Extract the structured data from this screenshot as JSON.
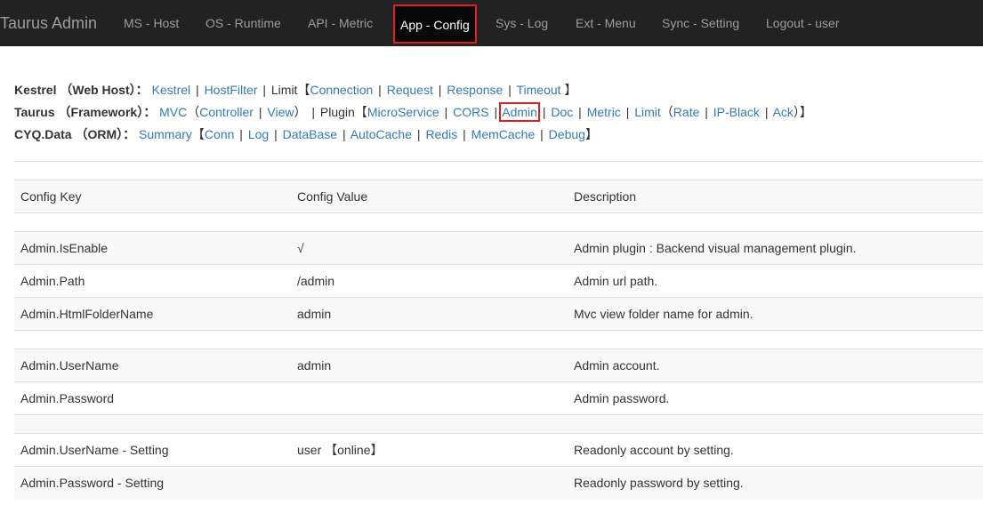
{
  "navbar": {
    "brand": "Taurus Admin",
    "items": [
      {
        "label": "MS - Host"
      },
      {
        "label": "OS - Runtime"
      },
      {
        "label": "API - Metric"
      },
      {
        "label": "App - Config",
        "active": true
      },
      {
        "label": "Sys - Log"
      },
      {
        "label": "Ext - Menu"
      },
      {
        "label": "Sync - Setting"
      },
      {
        "label": "Logout - user"
      }
    ]
  },
  "config_nav": {
    "kestrel": {
      "title": "Kestrel （Web Host）：",
      "kestrel": "Kestrel",
      "hostfilter": "HostFilter",
      "limit": "Limit",
      "open": "【",
      "connection": "Connection",
      "request": "Request",
      "response": "Response",
      "timeout": "Timeout",
      "close": "】"
    },
    "taurus": {
      "title": "Taurus （Framework）：",
      "mvc": "MVC",
      "paren_open": "（",
      "controller": "Controller",
      "view": "View",
      "paren_close": "）",
      "plugin": "Plugin",
      "open": "【",
      "microservice": "MicroService",
      "cors": "CORS",
      "admin": "Admin",
      "doc": "Doc",
      "metric": "Metric",
      "limit": "Limit",
      "paren_open2": "（",
      "rate": "Rate",
      "ipblack": "IP-Black",
      "ack": "Ack",
      "paren_close2": "）",
      "close": "】"
    },
    "cyq": {
      "title": "CYQ.Data （ORM）：",
      "summary": "Summary",
      "open": "【",
      "conn": "Conn",
      "log": "Log",
      "database": "DataBase",
      "autocache": "AutoCache",
      "redis": "Redis",
      "memcache": "MemCache",
      "debug": "Debug",
      "close": "】"
    },
    "separator": "|"
  },
  "table": {
    "headers": [
      "Config Key",
      "Config Value",
      "Description"
    ],
    "groups": [
      [
        {
          "key": "Admin.IsEnable",
          "value": "√",
          "desc": "Admin plugin : Backend visual management plugin."
        },
        {
          "key": "Admin.Path",
          "value": "/admin",
          "desc": "Admin url path."
        },
        {
          "key": "Admin.HtmlFolderName",
          "value": "admin",
          "desc": "Mvc view folder name for admin."
        }
      ],
      [
        {
          "key": "Admin.UserName",
          "value": "admin",
          "desc": "Admin account."
        },
        {
          "key": "Admin.Password",
          "value": "",
          "desc": "Admin password."
        }
      ],
      [
        {
          "key": "Admin.UserName - Setting",
          "value": "user 【online】",
          "desc": "Readonly account by setting."
        },
        {
          "key": "Admin.Password - Setting",
          "value": "",
          "desc": "Readonly password by setting."
        }
      ]
    ]
  },
  "colors": {
    "navbar_bg": "#222222",
    "link": "#337ab7",
    "highlight": "#e02020"
  }
}
